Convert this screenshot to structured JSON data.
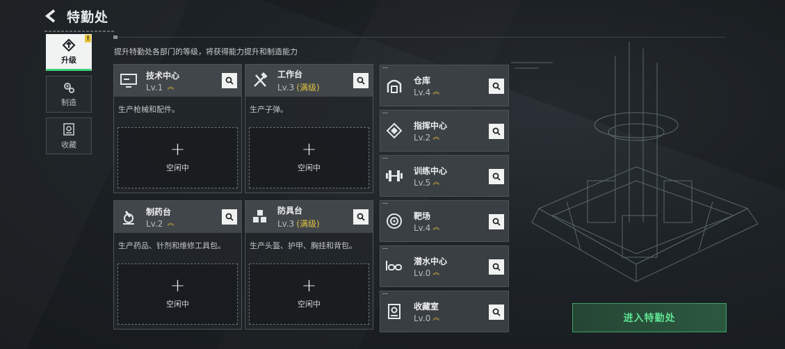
{
  "header": {
    "title": "特勤处"
  },
  "nav": {
    "items": [
      {
        "label": "升级",
        "active": true,
        "badge": "!"
      },
      {
        "label": "制造",
        "active": false
      },
      {
        "label": "收藏",
        "active": false
      }
    ]
  },
  "description": "提升特勤处各部门的等级，将获得能力提升和制造能力",
  "departments": [
    {
      "name": "技术中心",
      "level": "Lv.1",
      "maxed": "",
      "desc": "生产枪械和配件。",
      "slot": {
        "plus": "+",
        "label": "空闲中"
      }
    },
    {
      "name": "工作台",
      "level": "Lv.3",
      "maxed": "(满级)",
      "desc": "生产子弹。",
      "slot": {
        "plus": "+",
        "label": "空闲中"
      }
    },
    {
      "name": "制药台",
      "level": "Lv.2",
      "maxed": "",
      "desc": "生产药品、针剂和维修工具包。",
      "slot": {
        "plus": "+",
        "label": "空闲中"
      }
    },
    {
      "name": "防具台",
      "level": "Lv.3",
      "maxed": "(满级)",
      "desc": "生产头盔、护甲、胸挂和背包。",
      "slot": {
        "plus": "+",
        "label": "空闲中"
      }
    }
  ],
  "rooms": [
    {
      "name": "仓库",
      "level": "Lv.4",
      "icon": "warehouse-icon"
    },
    {
      "name": "指挥中心",
      "level": "Lv.2",
      "icon": "command-center-icon"
    },
    {
      "name": "训练中心",
      "level": "Lv.5",
      "icon": "dumbbell-icon"
    },
    {
      "name": "靶场",
      "level": "Lv.4",
      "icon": "target-icon"
    },
    {
      "name": "潜水中心",
      "level": "Lv.0",
      "icon": "diving-mask-icon"
    },
    {
      "name": "收藏室",
      "level": "Lv.0",
      "icon": "collection-icon"
    }
  ],
  "enter_button": "进入特勤处",
  "colors": {
    "accent_green": "#3fd17a",
    "maxed_gold": "#e2c144",
    "level_chevron": "#d6b23a"
  }
}
